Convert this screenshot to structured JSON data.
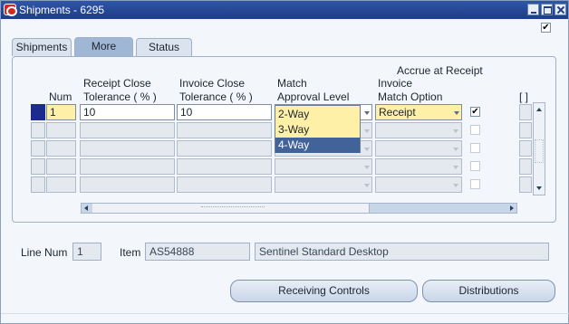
{
  "window": {
    "title": "Shipments - 6295"
  },
  "tabs": [
    {
      "label": "Shipments",
      "active": false
    },
    {
      "label": "More",
      "active": true
    },
    {
      "label": "Status",
      "active": false
    }
  ],
  "columns": {
    "num": "Num",
    "receipt_close_1": "Receipt Close",
    "receipt_close_2": "Tolerance ( % )",
    "invoice_close_1": "Invoice Close",
    "invoice_close_2": "Tolerance ( % )",
    "match_1": "Match",
    "match_2": "Approval Level",
    "invoice_match_1": "Invoice",
    "invoice_match_2": "Match Option",
    "accrue": "Accrue at Receipt",
    "folder": "[ ]"
  },
  "rows": [
    {
      "num": "1",
      "receipt_tol": "10",
      "invoice_tol": "10",
      "match_level": "",
      "invoice_option": "Receipt",
      "accrue_checked": true
    }
  ],
  "match_dropdown": {
    "options": [
      "2-Way",
      "3-Way",
      "4-Way"
    ],
    "highlighted": "4-Way"
  },
  "footer": {
    "line_num_label": "Line Num",
    "line_num_value": "1",
    "item_label": "Item",
    "item_value": "AS54888",
    "item_description": "Sentinel Standard Desktop"
  },
  "buttons": {
    "receiving_controls": "Receiving Controls",
    "distributions": "Distributions"
  },
  "top_checkbox": {
    "checked": true,
    "mark": "✔"
  },
  "accrue_mark": "✔",
  "colors": {
    "title_bar": "#1d3d87",
    "selected_field": "#fff0a8",
    "dropdown_highlight": "#42639a",
    "current_row_marker": "#1c2c8a"
  }
}
